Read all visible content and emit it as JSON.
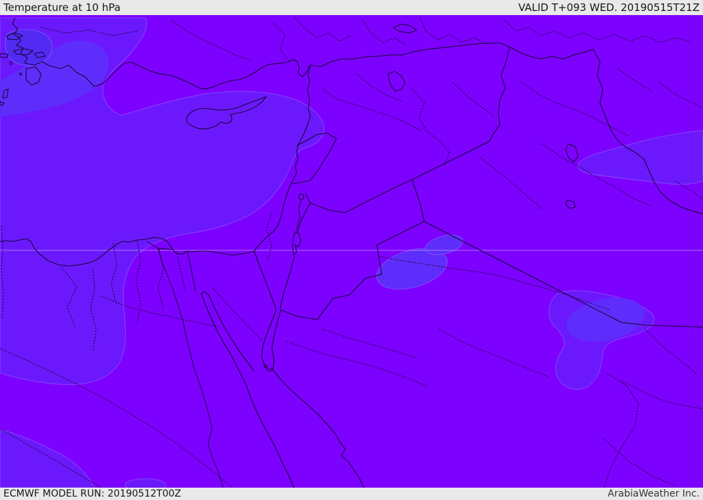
{
  "header": {
    "title": "Temperature at 10 hPa",
    "valid_label": "VALID T+093 WED. 20190515T21Z"
  },
  "footer": {
    "model_run_label": "ECMWF MODEL RUN: 20190512T00Z",
    "credit_label": "ArabiaWeather Inc."
  },
  "map": {
    "colors": {
      "primary": "#7d01fe",
      "secondary": "#6b19fc",
      "tertiary": "#5f2dfb",
      "deep": "#512bf2",
      "patch_edge": "#9a70ff",
      "line": "#160534",
      "graticule": "#d9cdf6",
      "bar_bg": "#e9e9e9",
      "bar_text": "#161616"
    }
  }
}
